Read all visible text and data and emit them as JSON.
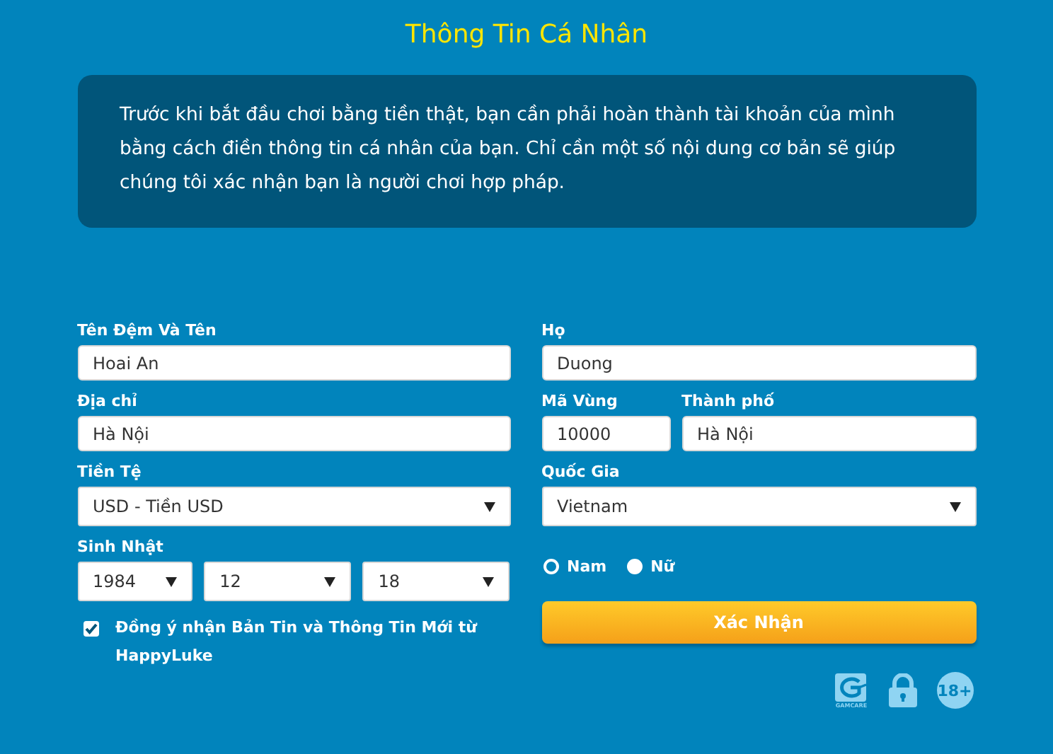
{
  "title": "Thông Tin Cá Nhân",
  "intro": "Trước khi bắt đầu chơi bằng tiền thật, bạn cần phải hoàn thành tài khoản của mình bằng cách điền thông tin cá nhân của bạn. Chỉ cần một số nội dung cơ bản sẽ giúp chúng tôi xác nhận bạn là người chơi hợp pháp.",
  "left": [
    {
      "kind": "text",
      "label": "Tên Đệm Và Tên",
      "value": "Hoai An"
    },
    {
      "kind": "text",
      "label": "Địa chỉ",
      "value": "Hà Nội"
    },
    {
      "kind": "select",
      "label": "Tiền Tệ",
      "value": "USD - Tiền USD"
    },
    {
      "kind": "date",
      "label": "Sinh Nhật",
      "parts": [
        "1984",
        "12",
        "18"
      ]
    }
  ],
  "newsletter": {
    "checked": true,
    "label": "Đồng ý nhận Bản Tin và Thông Tin Mới từ HappyLuke"
  },
  "right": [
    {
      "kind": "text",
      "label": "Họ",
      "value": "Duong"
    },
    {
      "kind": "pair",
      "items": [
        {
          "label": "Mã Vùng",
          "value": "10000"
        },
        {
          "label": "Thành phố",
          "value": "Hà Nội"
        }
      ]
    },
    {
      "kind": "select",
      "label": "Quốc Gia",
      "value": "Vietnam"
    }
  ],
  "gender": [
    {
      "label": "Nam",
      "selected": true
    },
    {
      "label": "Nữ",
      "selected": false
    }
  ],
  "submit": "Xác Nhận",
  "badges": {
    "gamcare": "GAMCARE",
    "age": "18+"
  }
}
